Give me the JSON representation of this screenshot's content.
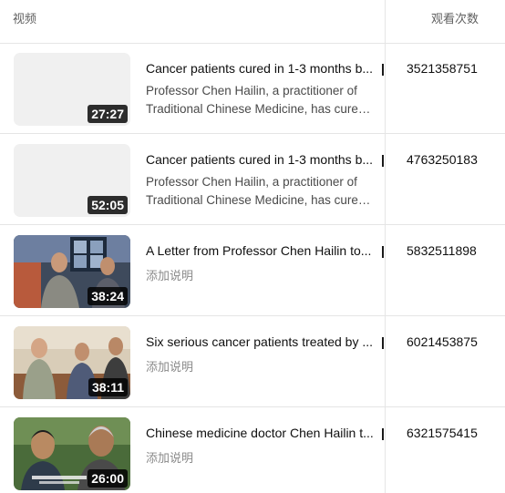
{
  "header": {
    "video_col": "视频",
    "views_col": "观看次数"
  },
  "rows": [
    {
      "title": "Cancer patients cured in 1-3 months b...",
      "desc_line1": "Professor Chen Hailin, a practitioner of",
      "desc_line2": "Traditional Chinese Medicine, has cured...",
      "duration": "27:27",
      "views": "3521358751"
    },
    {
      "title": "Cancer patients cured in 1-3 months b...",
      "desc_line1": "Professor Chen Hailin, a practitioner of",
      "desc_line2": "Traditional Chinese Medicine, has cured...",
      "duration": "52:05",
      "views": "4763250183"
    },
    {
      "title": "A Letter from Professor Chen Hailin to...",
      "add_desc": "添加说明",
      "duration": "38:24",
      "views": "5832511898"
    },
    {
      "title": "Six serious cancer patients treated by ...",
      "add_desc": "添加说明",
      "duration": "38:11",
      "views": "6021453875"
    },
    {
      "title": "Chinese medicine doctor Chen Hailin t...",
      "add_desc": "添加说明",
      "duration": "26:00",
      "views": "6321575415"
    }
  ]
}
